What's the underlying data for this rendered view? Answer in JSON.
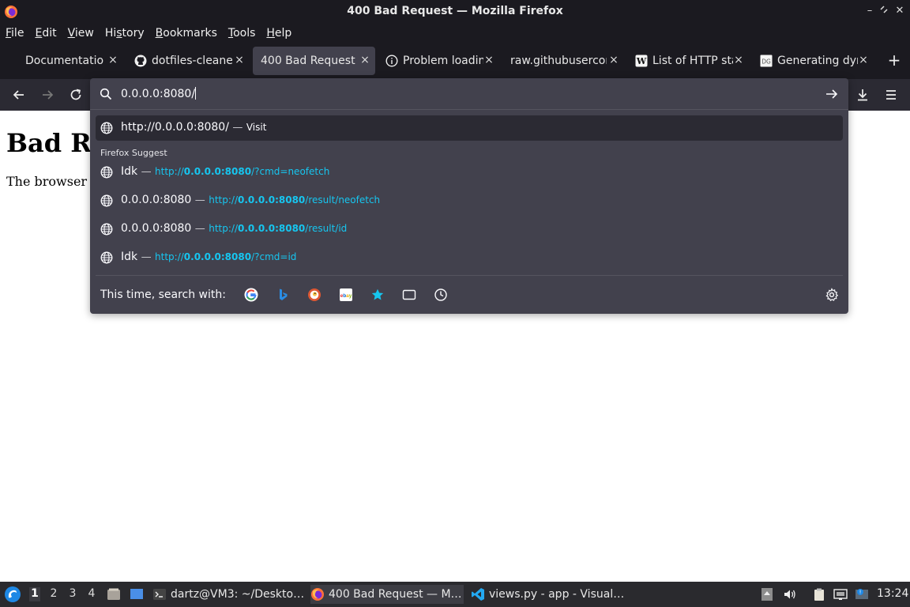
{
  "window": {
    "title": "400 Bad Request — Mozilla Firefox"
  },
  "menu": {
    "items": [
      {
        "label": "File",
        "accel": "F",
        "rest": "ile"
      },
      {
        "label": "Edit",
        "accel": "E",
        "rest": "dit"
      },
      {
        "label": "View",
        "accel": "V",
        "rest": "iew"
      },
      {
        "label": "History",
        "pre": "Hi",
        "accel": "s",
        "rest": "tory"
      },
      {
        "label": "Bookmarks",
        "accel": "B",
        "rest": "ookmarks"
      },
      {
        "label": "Tools",
        "accel": "T",
        "rest": "ools"
      },
      {
        "label": "Help",
        "accel": "H",
        "rest": "elp"
      }
    ]
  },
  "tabs": [
    {
      "label": "Documentation",
      "icon": "none",
      "active": false
    },
    {
      "label": "dotfiles-cleaner",
      "icon": "github-icon",
      "active": false
    },
    {
      "label": "400 Bad Request",
      "icon": "none",
      "active": true
    },
    {
      "label": "Problem loading",
      "icon": "info-icon",
      "active": false
    },
    {
      "label": "raw.githubuserconte",
      "icon": "none",
      "active": false
    },
    {
      "label": "List of HTTP sta",
      "icon": "wikipedia-icon",
      "active": false
    },
    {
      "label": "Generating dyn",
      "icon": "dg-icon",
      "active": false
    }
  ],
  "urlbar": {
    "value": "0.0.0.0:8080/"
  },
  "suggestions": {
    "heuristic": {
      "url": "http://0.0.0.0:8080/",
      "action": "Visit"
    },
    "group_label": "Firefox Suggest",
    "items": [
      {
        "title": "Idk",
        "url_pre": "http://",
        "url_bold": "0.0.0.0:8080",
        "url_post": "/?cmd=neofetch"
      },
      {
        "title": "0.0.0.0:8080",
        "url_pre": "http://",
        "url_bold": "0.0.0.0:8080",
        "url_post": "/result/neofetch"
      },
      {
        "title": "0.0.0.0:8080",
        "url_pre": "http://",
        "url_bold": "0.0.0.0:8080",
        "url_post": "/result/id"
      },
      {
        "title": "Idk",
        "url_pre": "http://",
        "url_bold": "0.0.0.0:8080",
        "url_post": "/?cmd=id"
      }
    ],
    "dash": "—",
    "search_with": "This time, search with:",
    "engines": [
      "google-icon",
      "bing-icon",
      "duckduckgo-icon",
      "ebay-icon",
      "bookmarks-star-icon",
      "tabs-icon",
      "history-clock-icon"
    ]
  },
  "page": {
    "heading": "Bad R",
    "text": "The browser"
  },
  "taskbar": {
    "workspaces": [
      "1",
      "2",
      "3",
      "4"
    ],
    "current_workspace": "1",
    "tasks": [
      {
        "label": "dartz@VM3: ~/Deskto…",
        "icon": "terminal-icon"
      },
      {
        "label": "400 Bad Request — M…",
        "icon": "firefox-icon",
        "active": true
      },
      {
        "label": "views.py - app - Visual…",
        "icon": "vscode-icon"
      }
    ],
    "clock": "13:24"
  },
  "colors": {
    "chrome_dark": "#1b1a20",
    "navbar": "#2b2a33",
    "panel": "#42414d",
    "link_accent": "#16c6f0"
  }
}
